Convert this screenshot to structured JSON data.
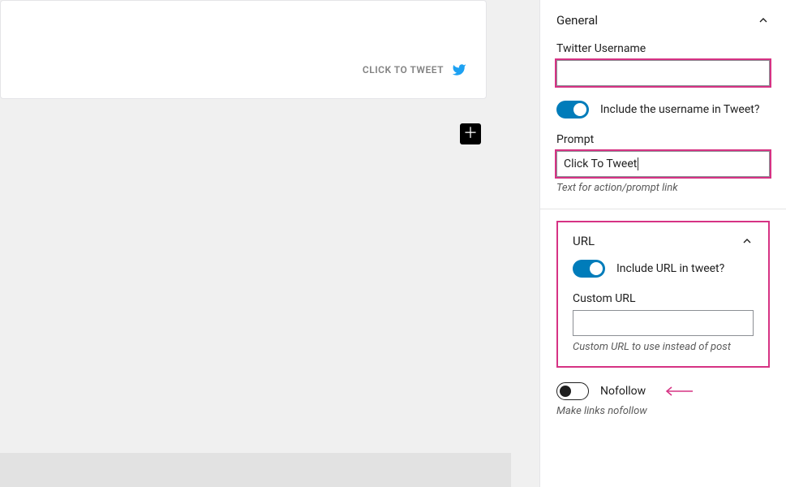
{
  "editor": {
    "ctt_label": "CLICK TO TWEET"
  },
  "panels": {
    "general": {
      "title": "General",
      "twitter_username_label": "Twitter Username",
      "twitter_username_value": "",
      "include_username_label": "Include the username in Tweet?",
      "prompt_label": "Prompt",
      "prompt_value": "Click To Tweet",
      "prompt_help": "Text for action/prompt link"
    },
    "url": {
      "title": "URL",
      "include_url_label": "Include URL in tweet?",
      "custom_url_label": "Custom URL",
      "custom_url_value": "",
      "custom_url_help": "Custom URL to use instead of post"
    },
    "nofollow": {
      "label": "Nofollow",
      "help": "Make links nofollow"
    }
  }
}
